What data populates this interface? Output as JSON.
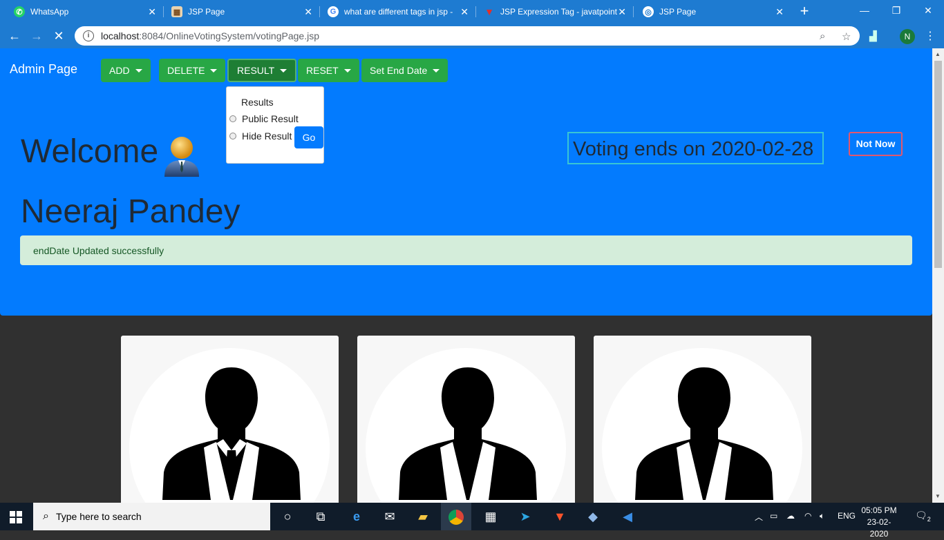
{
  "browser": {
    "tabs": [
      {
        "title": "WhatsApp",
        "favicon": "whatsapp-icon"
      },
      {
        "title": "JSP Page",
        "favicon": "page-icon"
      },
      {
        "title": "what are different tags in jsp -",
        "favicon": "google-icon"
      },
      {
        "title": "JSP Expression Tag - javatpoint",
        "favicon": "javatpoint-icon"
      },
      {
        "title": "JSP Page",
        "favicon": "page-icon"
      }
    ],
    "url_host": "localhost",
    "url_path": ":8084/OnlineVotingSystem/votingPage.jsp",
    "profile_initial": "N"
  },
  "navbar": {
    "brand": "Admin Page",
    "buttons": [
      "ADD",
      "DELETE",
      "RESULT",
      "RESET",
      "Set End Date"
    ]
  },
  "result_dropdown": {
    "title": "Results",
    "options": [
      "Public Result",
      "Hide Result"
    ],
    "go_label": "Go"
  },
  "main": {
    "welcome": "Welcome",
    "username": "Neeraj Pandey",
    "alert": "endDate Updated successfully",
    "voting_end": "Voting ends on 2020-02-28",
    "not_now": "Not Now"
  },
  "taskbar": {
    "search_placeholder": "Type here to search",
    "language": "ENG",
    "time": "05:05 PM",
    "date": "23-02-2020",
    "notification_count": "2"
  },
  "colors": {
    "chrome": "#1e7bd1",
    "header": "#037bfe",
    "button_green": "#28a745",
    "alert_bg": "#d4edda",
    "page_bg": "#303030"
  }
}
